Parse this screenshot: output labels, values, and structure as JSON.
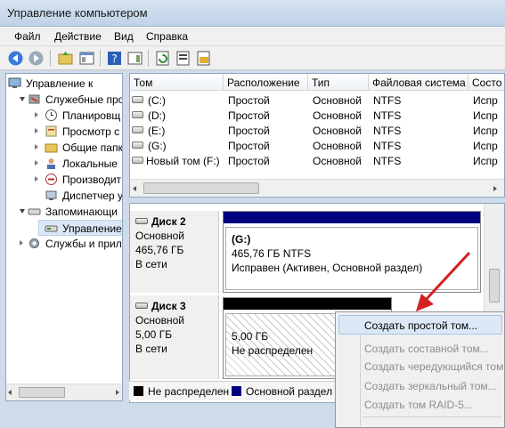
{
  "window": {
    "title": "Управление компьютером"
  },
  "menu": [
    "Файл",
    "Действие",
    "Вид",
    "Справка"
  ],
  "tree": {
    "items": [
      "Управление к",
      "Служебные про",
      "Планировщ",
      "Просмотр с",
      "Общие папк",
      "Локальные",
      "Производит",
      "Диспетчер у",
      "Запоминающи",
      "Управление",
      "Службы и прил"
    ]
  },
  "volumes": {
    "columns": [
      "Том",
      "Расположение",
      "Тип",
      "Файловая система",
      "Состо"
    ],
    "rows": [
      [
        "(C:)",
        "Простой",
        "Основной",
        "NTFS",
        "Испр"
      ],
      [
        "(D:)",
        "Простой",
        "Основной",
        "NTFS",
        "Испр"
      ],
      [
        "(E:)",
        "Простой",
        "Основной",
        "NTFS",
        "Испр"
      ],
      [
        "(G:)",
        "Простой",
        "Основной",
        "NTFS",
        "Испр"
      ],
      [
        "Новый том (F:)",
        "Простой",
        "Основной",
        "NTFS",
        "Испр"
      ]
    ]
  },
  "disks": [
    {
      "name": "Диск 2",
      "type": "Основной",
      "size": "465,76 ГБ",
      "status": "В сети",
      "partition": {
        "label": "(G:)",
        "size": "465,76 ГБ NTFS",
        "status": "Исправен (Активен, Основной раздел)"
      }
    },
    {
      "name": "Диск 3",
      "type": "Основной",
      "size": "5,00 ГБ",
      "status": "В сети",
      "partition": {
        "size": "5,00 ГБ",
        "status": "Не распределен"
      }
    }
  ],
  "legend": {
    "unallocated": "Не распределен",
    "primary": "Основной раздел"
  },
  "context_menu": [
    {
      "label": "Создать простой том...",
      "enabled": true
    },
    {
      "label": "Создать составной том...",
      "enabled": false
    },
    {
      "label": "Создать чередующийся том...",
      "enabled": false
    },
    {
      "label": "Создать зеркальный том...",
      "enabled": false
    },
    {
      "label": "Создать том RAID-5...",
      "enabled": false
    }
  ],
  "colors": {
    "primary_partition": "#000080",
    "unallocated": "#000000",
    "arrow": "#e02020",
    "highlight": "#dde8f6"
  }
}
